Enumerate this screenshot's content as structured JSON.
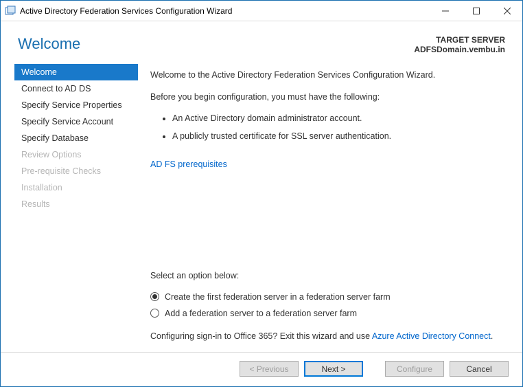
{
  "window": {
    "title": "Active Directory Federation Services Configuration Wizard"
  },
  "header": {
    "page_title": "Welcome",
    "target_label": "TARGET SERVER",
    "target_value": "ADFSDomain.vembu.in"
  },
  "sidebar": {
    "items": [
      {
        "label": "Welcome",
        "state": "active"
      },
      {
        "label": "Connect to AD DS",
        "state": "normal"
      },
      {
        "label": "Specify Service Properties",
        "state": "normal"
      },
      {
        "label": "Specify Service Account",
        "state": "normal"
      },
      {
        "label": "Specify Database",
        "state": "normal"
      },
      {
        "label": "Review Options",
        "state": "disabled"
      },
      {
        "label": "Pre-requisite Checks",
        "state": "disabled"
      },
      {
        "label": "Installation",
        "state": "disabled"
      },
      {
        "label": "Results",
        "state": "disabled"
      }
    ]
  },
  "content": {
    "intro": "Welcome to the Active Directory Federation Services Configuration Wizard.",
    "before": "Before you begin configuration, you must have the following:",
    "bullets": [
      "An Active Directory domain administrator account.",
      "A publicly trusted certificate for SSL server authentication."
    ],
    "prereq_link": "AD FS prerequisites",
    "select_label": "Select an option below:",
    "options": [
      {
        "label": "Create the first federation server in a federation server farm",
        "selected": true
      },
      {
        "label": "Add a federation server to a federation server farm",
        "selected": false
      }
    ],
    "o365_prefix": "Configuring sign-in to Office 365? Exit this wizard and use ",
    "o365_link": "Azure Active Directory Connect",
    "o365_suffix": "."
  },
  "footer": {
    "previous": "< Previous",
    "next": "Next >",
    "configure": "Configure",
    "cancel": "Cancel"
  }
}
